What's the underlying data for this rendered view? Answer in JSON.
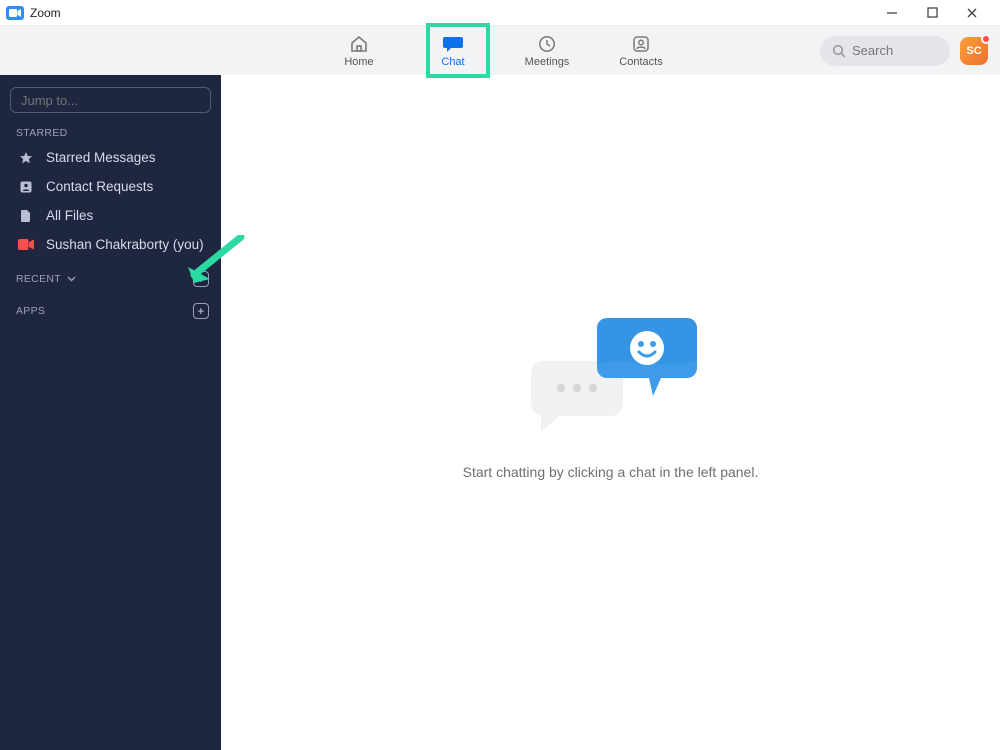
{
  "window": {
    "title": "Zoom"
  },
  "nav": {
    "home": "Home",
    "chat": "Chat",
    "meetings": "Meetings",
    "contacts": "Contacts"
  },
  "search": {
    "placeholder": "Search"
  },
  "avatar": {
    "initials": "SC"
  },
  "sidebar": {
    "jump_placeholder": "Jump to...",
    "starred_header": "STARRED",
    "recent_header": "RECENT",
    "apps_header": "APPS",
    "items": {
      "starred_messages": "Starred Messages",
      "contact_requests": "Contact Requests",
      "all_files": "All Files",
      "self_chat": "Sushan Chakraborty (you)"
    }
  },
  "main": {
    "empty_hint": "Start chatting by clicking a chat in the left panel."
  },
  "colors": {
    "highlight": "#2BD9A4",
    "zoom_blue": "#2D8CFF",
    "sidebar_bg": "#1f2640"
  }
}
